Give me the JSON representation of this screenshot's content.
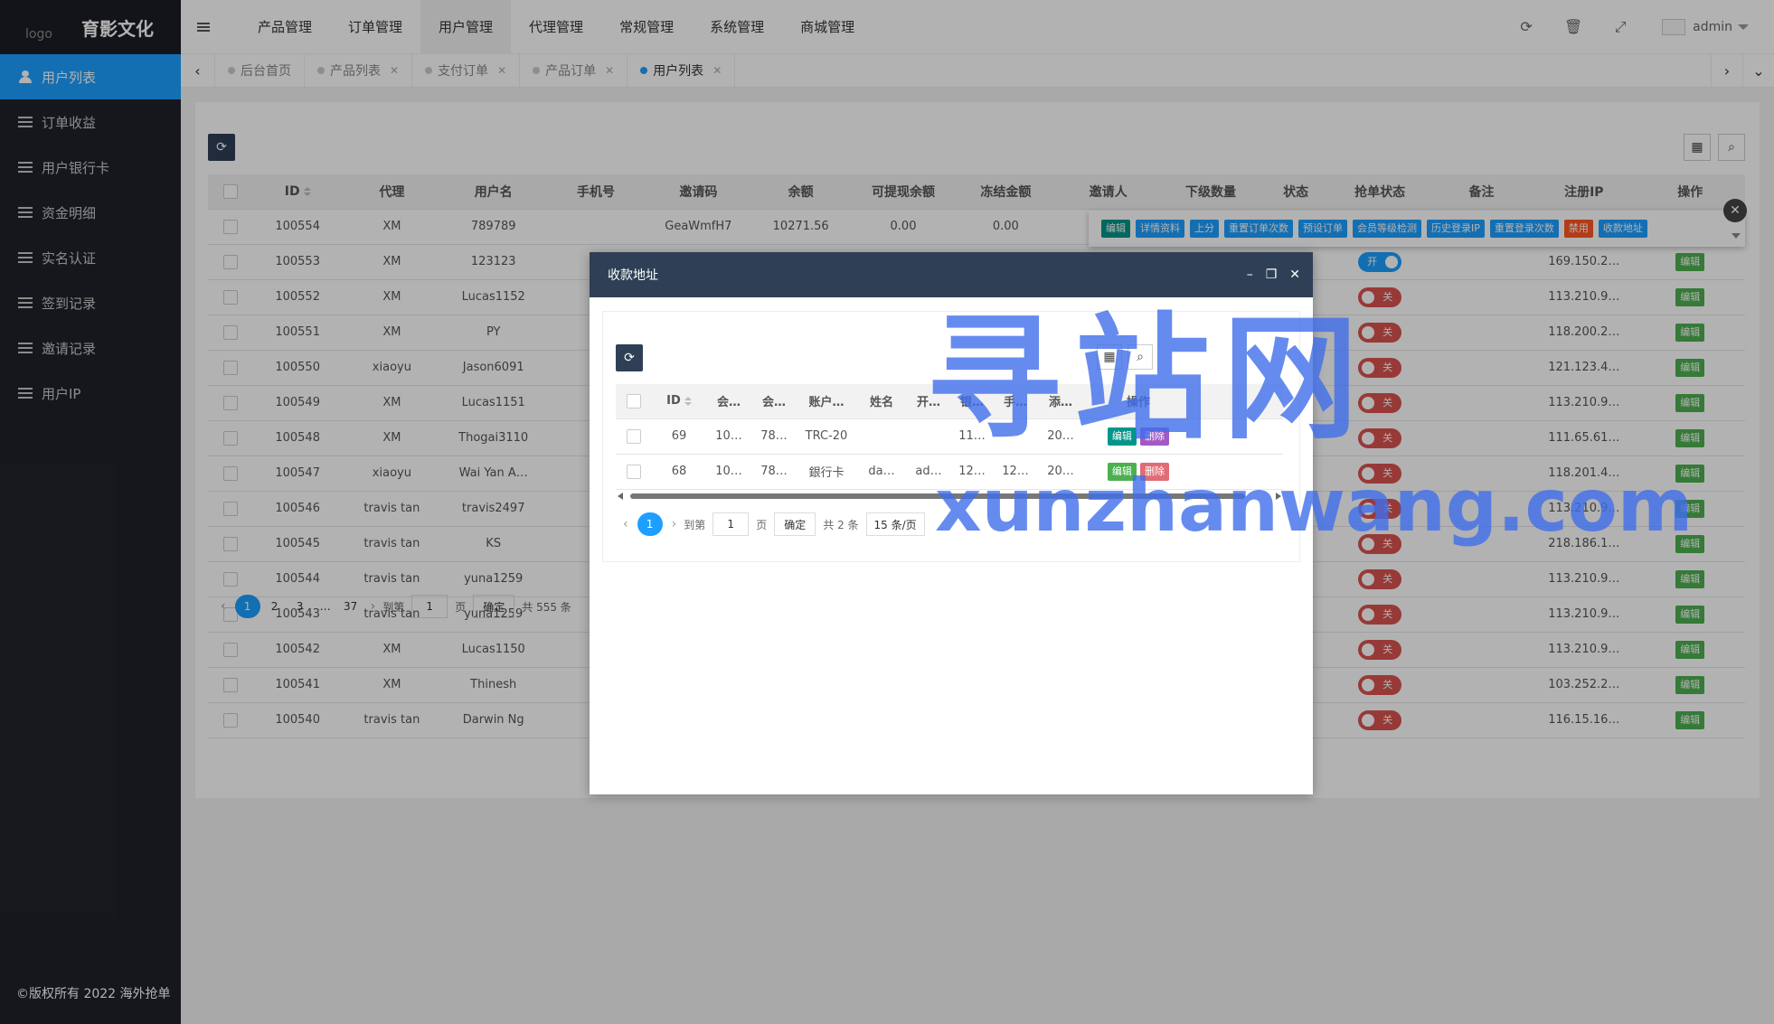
{
  "sidebar": {
    "logo_alt": "logo",
    "brand": "育影文化",
    "items": [
      {
        "label": "用户列表",
        "icon": "users-icon",
        "active": true
      },
      {
        "label": "订单收益",
        "icon": "list-icon"
      },
      {
        "label": "用户银行卡",
        "icon": "list-icon"
      },
      {
        "label": "资金明细",
        "icon": "list-icon"
      },
      {
        "label": "实名认证",
        "icon": "list-icon"
      },
      {
        "label": "签到记录",
        "icon": "list-icon"
      },
      {
        "label": "邀请记录",
        "icon": "list-icon"
      },
      {
        "label": "用户IP",
        "icon": "list-icon"
      }
    ],
    "copyright": "©版权所有 2022 海外抢单"
  },
  "topbar": {
    "nav": [
      "产品管理",
      "订单管理",
      "用户管理",
      "代理管理",
      "常规管理",
      "系统管理",
      "商城管理"
    ],
    "active_nav": "用户管理",
    "username": "admin",
    "icons": [
      "refresh-icon",
      "trash-icon",
      "fullscreen-icon"
    ]
  },
  "tabs": [
    {
      "label": "后台首页",
      "closable": false
    },
    {
      "label": "产品列表",
      "closable": true
    },
    {
      "label": "支付订单",
      "closable": true
    },
    {
      "label": "产品订单",
      "closable": true
    },
    {
      "label": "用户列表",
      "closable": true,
      "active": true
    }
  ],
  "table": {
    "headers": [
      "ID",
      "代理",
      "用户名",
      "手机号",
      "邀请码",
      "余额",
      "可提现余额",
      "冻结金额",
      "邀请人",
      "下级数量",
      "状态",
      "抢单状态",
      "备注",
      "注册IP",
      "操作"
    ],
    "rows": [
      {
        "id": "100554",
        "agent": "XM",
        "username": "789789",
        "phone": "",
        "code": "GeaWmfH7",
        "balance": "10271.56",
        "withdrawable": "0.00",
        "frozen": "0.00",
        "ip": "",
        "grab": "",
        "op": ""
      },
      {
        "id": "100553",
        "agent": "XM",
        "username": "123123",
        "ip": "169.150.2…",
        "grab": "开",
        "op": "编辑"
      },
      {
        "id": "100552",
        "agent": "XM",
        "username": "Lucas1152",
        "ip": "113.210.9…",
        "grab": "关",
        "op": "编辑"
      },
      {
        "id": "100551",
        "agent": "XM",
        "username": "PY",
        "ip": "118.200.2…",
        "grab": "关",
        "op": "编辑"
      },
      {
        "id": "100550",
        "agent": "xiaoyu",
        "username": "Jason6091",
        "ip": "121.123.4…",
        "grab": "关",
        "op": "编辑"
      },
      {
        "id": "100549",
        "agent": "XM",
        "username": "Lucas1151",
        "ip": "113.210.9…",
        "grab": "关",
        "op": "编辑"
      },
      {
        "id": "100548",
        "agent": "XM",
        "username": "Thogai3110",
        "ip": "111.65.61…",
        "grab": "关",
        "op": "编辑"
      },
      {
        "id": "100547",
        "agent": "xiaoyu",
        "username": "Wai Yan A…",
        "ip": "118.201.4…",
        "grab": "关",
        "op": "编辑"
      },
      {
        "id": "100546",
        "agent": "travis tan",
        "username": "travis2497",
        "ip": "113.210.9…",
        "grab": "关",
        "op": "编辑"
      },
      {
        "id": "100545",
        "agent": "travis tan",
        "username": "KS",
        "ip": "218.186.1…",
        "grab": "关",
        "op": "编辑"
      },
      {
        "id": "100544",
        "agent": "travis tan",
        "username": "yuna1259",
        "ip": "113.210.9…",
        "grab": "关",
        "op": "编辑"
      },
      {
        "id": "100543",
        "agent": "travis tan",
        "username": "yuna1259",
        "ip": "113.210.9…",
        "grab": "关",
        "op": "编辑"
      },
      {
        "id": "100542",
        "agent": "XM",
        "username": "Lucas1150",
        "ip": "113.210.9…",
        "grab": "关",
        "op": "编辑"
      },
      {
        "id": "100541",
        "agent": "XM",
        "username": "Thinesh",
        "ip": "103.252.2…",
        "grab": "关",
        "op": "编辑"
      },
      {
        "id": "100540",
        "agent": "travis tan",
        "username": "Darwin Ng",
        "ip": "116.15.16…",
        "grab": "关",
        "op": "编辑"
      }
    ]
  },
  "row_actions": [
    "编辑",
    "详情资料",
    "上分",
    "重置订单次数",
    "预设订单",
    "会员等级检测",
    "历史登录IP",
    "重置登录次数",
    "禁用",
    "收款地址"
  ],
  "pager": {
    "pages": [
      "1",
      "2",
      "3",
      "…",
      "37"
    ],
    "goto_label": "到第",
    "page_value": "1",
    "page_unit": "页",
    "confirm": "确定",
    "total": "共 555 条"
  },
  "modal": {
    "title": "收款地址",
    "headers": [
      "ID",
      "会…",
      "会…",
      "账户…",
      "姓名",
      "开…",
      "银…",
      "手…",
      "添…",
      "操作"
    ],
    "rows": [
      {
        "cells": [
          "69",
          "10…",
          "78…",
          "TRC-20",
          "",
          "",
          "11…",
          "",
          "20…"
        ]
      },
      {
        "cells": [
          "68",
          "10…",
          "78…",
          "銀行卡",
          "da…",
          "ad…",
          "12…",
          "12…",
          "20…"
        ]
      }
    ],
    "edit": "编辑",
    "delete": "删除",
    "pager": {
      "page": "1",
      "goto_label": "到第",
      "page_value": "1",
      "page_unit": "页",
      "confirm": "确定",
      "total": "共 2 条",
      "per_page": "15 条/页"
    }
  },
  "watermark": {
    "cn": "寻站网",
    "en": "xunzhanwang.com"
  }
}
